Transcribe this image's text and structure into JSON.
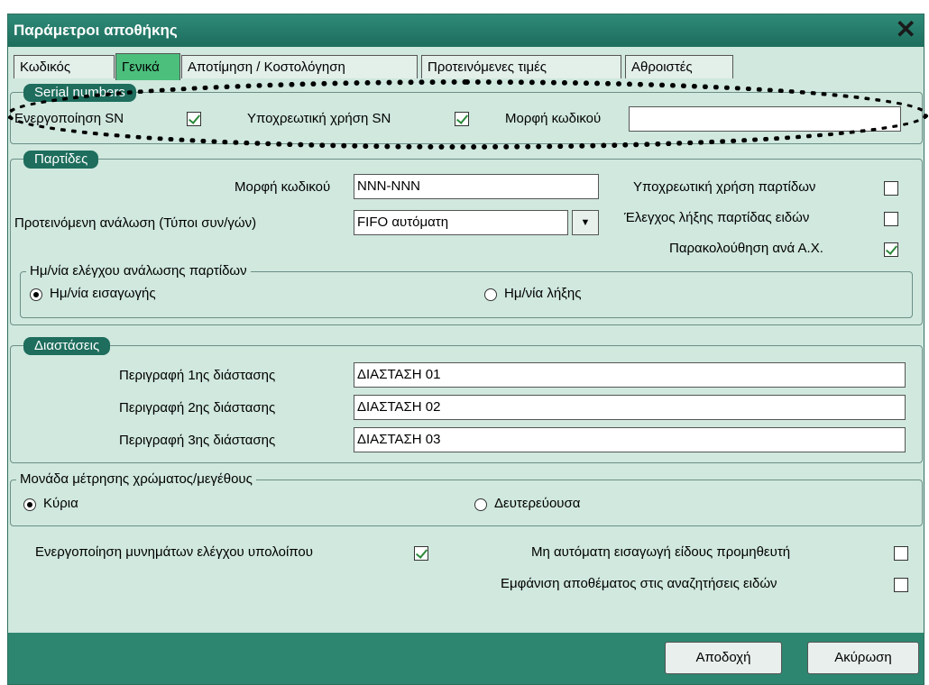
{
  "window": {
    "title": "Παράμετροι αποθήκης"
  },
  "tabs": [
    {
      "label": "Κωδικός"
    },
    {
      "label": "Γενικά"
    },
    {
      "label": "Αποτίμηση / Κοστολόγηση"
    },
    {
      "label": "Προτεινόμενες τιμές"
    },
    {
      "label": "Αθροιστές"
    }
  ],
  "serial": {
    "title": "Serial numbers",
    "enable_label": "Ενεργοποίηση SN",
    "enable_checked": true,
    "mandatory_label": "Υποχρεωτική χρήση SN",
    "mandatory_checked": true,
    "format_label": "Μορφή κωδικού",
    "format_value": ""
  },
  "batches": {
    "title": "Παρτίδες",
    "format_label": "Μορφή κωδικού",
    "format_value": "NNN-NNN",
    "consumption_label": "Προτεινόμενη ανάλωση (Τύποι συν/γών)",
    "consumption_value": "FIFO αυτόματη",
    "mandatory_label": "Υποχρεωτική χρήση παρτίδων",
    "mandatory_checked": false,
    "expiry_check_label": "Έλεγχος λήξης παρτίδας ειδών",
    "expiry_check_checked": false,
    "tracking_label": "Παρακολούθηση ανά Α.Χ.",
    "tracking_checked": true,
    "date_group_title": "Ημ/νία ελέγχου ανάλωσης παρτίδων",
    "date_import_label": "Ημ/νία εισαγωγής",
    "date_expiry_label": "Ημ/νία λήξης",
    "selected_date": "import"
  },
  "dimensions": {
    "title": "Διαστάσεις",
    "rows": [
      {
        "label": "Περιγραφή 1ης διάστασης",
        "value": "ΔΙΑΣΤΑΣΗ 01"
      },
      {
        "label": "Περιγραφή 2ης διάστασης",
        "value": "ΔΙΑΣΤΑΣΗ 02"
      },
      {
        "label": "Περιγραφή 3ης διάστασης",
        "value": "ΔΙΑΣΤΑΣΗ 03"
      }
    ]
  },
  "unit": {
    "title": "Μονάδα μέτρησης χρώματος/μεγέθους",
    "primary_label": "Κύρια",
    "secondary_label": "Δευτερεύουσα",
    "selected": "primary"
  },
  "options": {
    "balance_msgs_label": "Ενεργοποίηση μυνημάτων ελέγχου υπολοίπου",
    "balance_msgs_checked": true,
    "no_auto_supplier_label": "Μη αυτόματη εισαγωγή είδους προμηθευτή",
    "no_auto_supplier_checked": false,
    "show_stock_label": "Εμφάνιση αποθέματος στις αναζητήσεις ειδών",
    "show_stock_checked": false
  },
  "buttons": {
    "ok": "Αποδοχή",
    "cancel": "Ακύρωση"
  },
  "icons": {
    "close": "close-icon",
    "dropdown": "chevron-down-icon"
  },
  "colors": {
    "titlebar": "#1d6d5c",
    "active_tab": "#4cbf7d",
    "background": "#d0e8de"
  }
}
